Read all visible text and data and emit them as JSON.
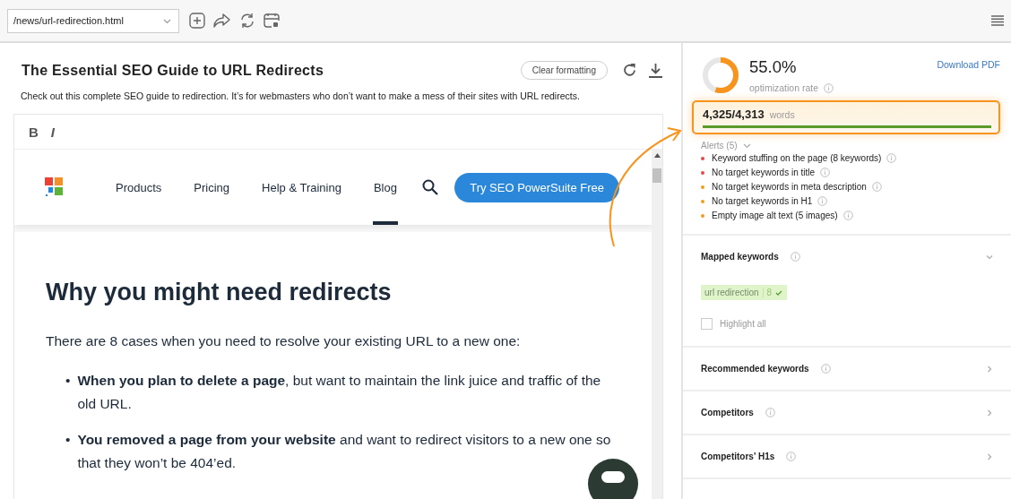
{
  "toolbar": {
    "url_field": {
      "value": "/news/url-redirection.html"
    }
  },
  "document": {
    "title": "The Essential SEO Guide to URL Redirects",
    "description": "Check out this complete SEO guide to redirection. It’s for webmasters who don’t want to make a mess of their sites with URL redirects.",
    "clear_button": "Clear formatting",
    "format_buttons": [
      {
        "label": "B",
        "kind": "bold"
      },
      {
        "label": "I",
        "kind": "italic"
      }
    ],
    "site_nav": {
      "items": [
        {
          "label": "Products",
          "selected": false
        },
        {
          "label": "Pricing",
          "selected": false
        },
        {
          "label": "Help & Training",
          "selected": false
        },
        {
          "label": "Blog",
          "selected": true
        }
      ],
      "cta": "Try SEO PowerSuite Free"
    },
    "article": {
      "heading": "Why you might need redirects",
      "intro": "There are 8 cases when you need to resolve your existing URL to a new one:",
      "bullets": [
        {
          "marker": "•",
          "text": "**When you plan to delete a page**, but want to maintain the link juice and traffic of the old URL."
        },
        {
          "marker": "•",
          "text": "**You removed a page from your website** and want to redirect visitors to a new one so that they won’t be 404’ed."
        }
      ]
    }
  },
  "panel": {
    "optimization": {
      "rate": "55.0%",
      "level": 0.55,
      "label": "optimization rate"
    },
    "download": "Download PDF",
    "words": {
      "count": "4,325/4,313",
      "label": "words",
      "level": 1.0
    },
    "alerts": {
      "title": "Alerts (5)",
      "expanded": true,
      "items": [
        {
          "text": "Keyword stuffing on the page (8 keywords)",
          "color": "#e8474a"
        },
        {
          "text": "No target keywords in title",
          "color": "#e8474a"
        },
        {
          "text": "No target keywords in meta description",
          "color": "#f59a1b"
        },
        {
          "text": "No target keywords in H1",
          "color": "#f59a1b"
        },
        {
          "text": "Empty image alt text (5 images)",
          "color": "#f59a1b"
        }
      ]
    },
    "sections": [
      {
        "title": "Mapped keywords",
        "expanded": true,
        "keywords": [
          {
            "text": "url redirection",
            "count": "8"
          }
        ],
        "highlight": {
          "label": "Highlight all",
          "checked": false
        }
      },
      {
        "title": "Recommended keywords",
        "expanded": false
      },
      {
        "title": "Competitors",
        "expanded": false
      },
      {
        "title": "Competitors' H1s",
        "expanded": false
      }
    ]
  }
}
